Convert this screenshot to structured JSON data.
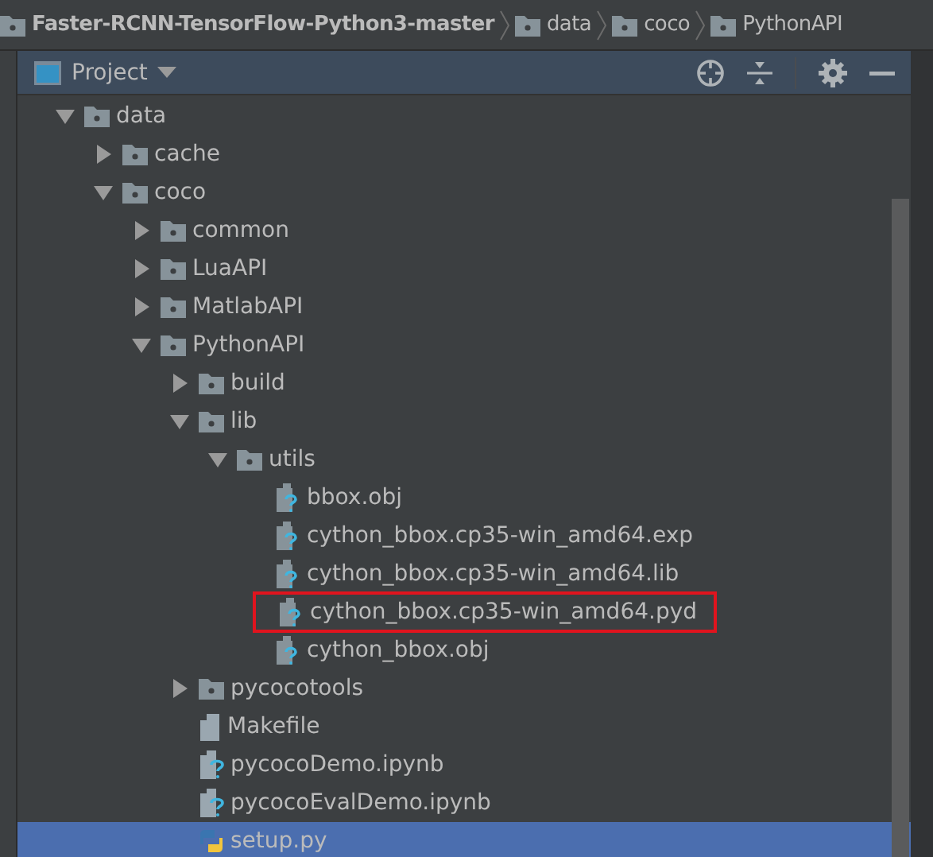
{
  "breadcrumbs": [
    {
      "label": "Faster-RCNN-TensorFlow-Python3-master",
      "kind": "project"
    },
    {
      "label": "data",
      "kind": "folder"
    },
    {
      "label": "coco",
      "kind": "folder"
    },
    {
      "label": "PythonAPI",
      "kind": "folder"
    }
  ],
  "panel": {
    "title": "Project"
  },
  "tree": [
    {
      "label": "data",
      "kind": "folder",
      "expanded": true,
      "selected": false,
      "children": [
        {
          "label": "cache",
          "kind": "folder",
          "expanded": false,
          "selected": false
        },
        {
          "label": "coco",
          "kind": "folder",
          "expanded": true,
          "selected": false,
          "children": [
            {
              "label": "common",
              "kind": "folder",
              "expanded": false,
              "selected": false
            },
            {
              "label": "LuaAPI",
              "kind": "folder",
              "expanded": false,
              "selected": false
            },
            {
              "label": "MatlabAPI",
              "kind": "folder",
              "expanded": false,
              "selected": false
            },
            {
              "label": "PythonAPI",
              "kind": "folder",
              "expanded": true,
              "selected": false,
              "children": [
                {
                  "label": "build",
                  "kind": "folder",
                  "expanded": false,
                  "selected": false
                },
                {
                  "label": "lib",
                  "kind": "folder",
                  "expanded": true,
                  "selected": false,
                  "children": [
                    {
                      "label": "utils",
                      "kind": "folder",
                      "expanded": true,
                      "selected": false,
                      "children": [
                        {
                          "label": "bbox.obj",
                          "kind": "unknown",
                          "selected": false,
                          "annotated": false
                        },
                        {
                          "label": "cython_bbox.cp35-win_amd64.exp",
                          "kind": "unknown",
                          "selected": false,
                          "annotated": false
                        },
                        {
                          "label": "cython_bbox.cp35-win_amd64.lib",
                          "kind": "unknown",
                          "selected": false,
                          "annotated": false
                        },
                        {
                          "label": "cython_bbox.cp35-win_amd64.pyd",
                          "kind": "unknown",
                          "selected": false,
                          "annotated": true
                        },
                        {
                          "label": "cython_bbox.obj",
                          "kind": "unknown",
                          "selected": false,
                          "annotated": false
                        }
                      ]
                    }
                  ]
                },
                {
                  "label": "pycocotools",
                  "kind": "folder",
                  "expanded": false,
                  "selected": false
                },
                {
                  "label": "Makefile",
                  "kind": "text",
                  "selected": false
                },
                {
                  "label": "pycocoDemo.ipynb",
                  "kind": "notebook",
                  "selected": false
                },
                {
                  "label": "pycocoEvalDemo.ipynb",
                  "kind": "notebook",
                  "selected": false
                },
                {
                  "label": "setup.py",
                  "kind": "python",
                  "selected": true
                }
              ]
            }
          ]
        }
      ]
    }
  ]
}
